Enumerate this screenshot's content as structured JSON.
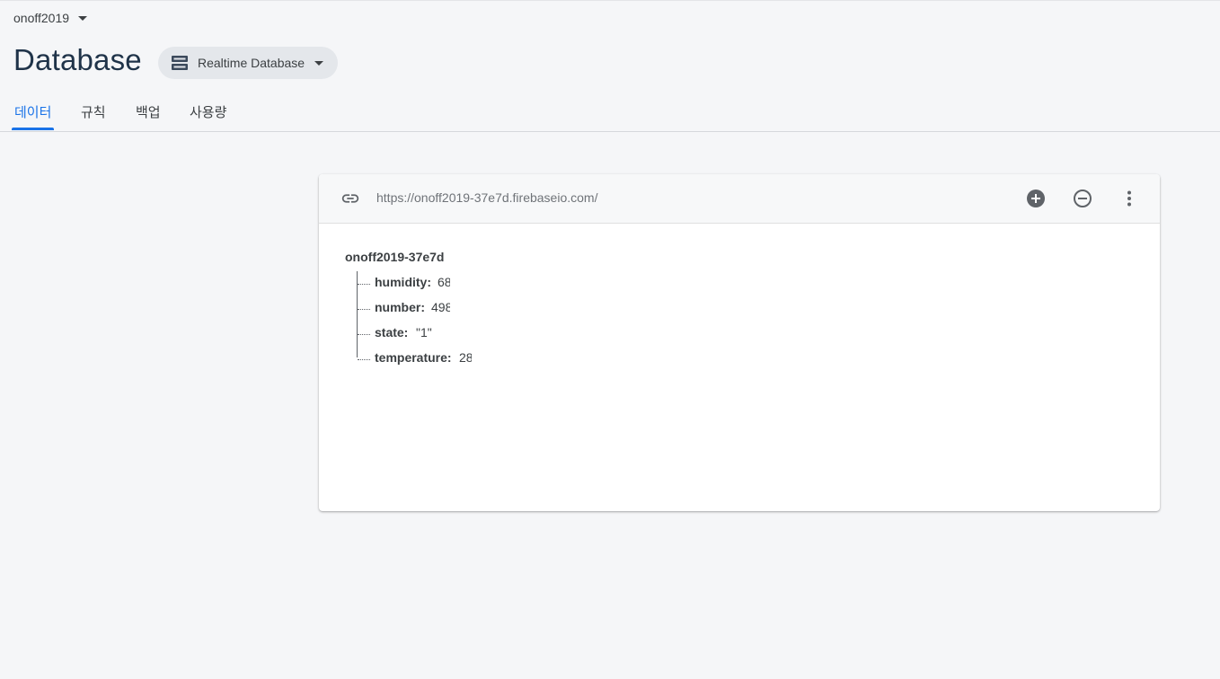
{
  "project": {
    "name": "onoff2019"
  },
  "page": {
    "title": "Database"
  },
  "db_selector": {
    "label": "Realtime Database",
    "icon": "database-icon"
  },
  "tabs": [
    {
      "label": "데이터",
      "active": true
    },
    {
      "label": "규칙",
      "active": false
    },
    {
      "label": "백업",
      "active": false
    },
    {
      "label": "사용량",
      "active": false
    }
  ],
  "panel": {
    "url": "https://onoff2019-37e7d.firebaseio.com/",
    "actions": [
      "add-circle-icon",
      "remove-circle-icon",
      "more-vert-icon"
    ]
  },
  "tree": {
    "root": "onoff2019-37e7d",
    "children": [
      {
        "key": "humidity:",
        "value": "68"
      },
      {
        "key": "number:",
        "value": "498"
      },
      {
        "key": "state:",
        "value": "\"1\""
      },
      {
        "key": "temperature:",
        "value": "28"
      }
    ]
  },
  "colors": {
    "accent": "#1a73e8",
    "title": "#1f3349",
    "background": "#f5f6f8"
  }
}
